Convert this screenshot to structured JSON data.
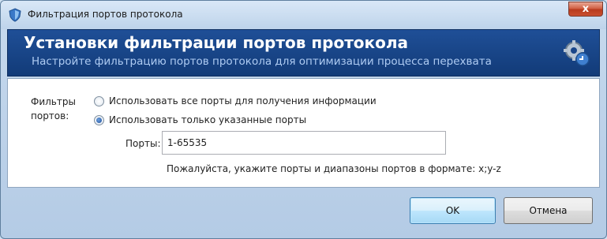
{
  "window": {
    "title": "Фильтрация портов протокола",
    "close_glyph": "x"
  },
  "header": {
    "title": "Установки фильтрации портов протокола",
    "subtitle": "Настройте фильтрацию портов протокола для оптимизации процесса перехвата"
  },
  "form": {
    "filters_label_line1": "Фильтры",
    "filters_label_line2": "портов:",
    "options": [
      {
        "label": "Использовать все порты для получения информации",
        "checked": false
      },
      {
        "label": "Использовать только указанные порты",
        "checked": true
      }
    ],
    "ports_label": "Порты:",
    "ports_value": "1-65535",
    "hint": "Пожалуйста, укажите порты и диапазоны портов в формате: x;y-z"
  },
  "buttons": {
    "ok": "OK",
    "cancel": "Отмена"
  },
  "colors": {
    "header_bg": "#1a4689",
    "header_title": "#ffffff",
    "header_subtitle": "#aecbf2",
    "close_button": "#c94f2f"
  }
}
